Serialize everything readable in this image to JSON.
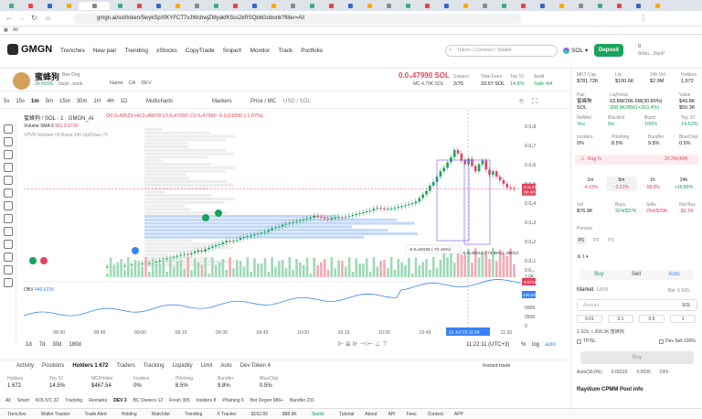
{
  "browser": {
    "url": "gmgn.ai/sol/token/5wykSpXfKYFCT7vJWcbwjZMyakfK5ss2kRSQb6Gobonk?filter=All",
    "bookmark": "All"
  },
  "header": {
    "logo": "GMGN",
    "nav": [
      "Trenches",
      "New pair",
      "Trending",
      "xStocks",
      "CopyTrade",
      "SnipeX",
      "Monitor",
      "Track",
      "Portfolio"
    ],
    "search_placeholder": "Token / Contract / Wallet",
    "chain": "SOL",
    "deposit": "Deposit",
    "wallet_balance": "0",
    "wallet_addr": "8dan...8qoP"
  },
  "token": {
    "name": "蜜蜂狗",
    "sub": "Bee Dog",
    "age": "2h HODL",
    "links": "5wyk...bonk",
    "tags": [
      "Name",
      "CA",
      "DEV"
    ],
    "price": "0.0₄47990 SOL",
    "mc": "MC 4.79K SOL",
    "snipers_label": "Snipers",
    "snipers": "2/70",
    "fees_label": "Total Fees",
    "fees": "33.97 SOL",
    "top10_label": "Top 10",
    "top10": "14.8%",
    "audit_label": "Audit",
    "audit": "Safe 4/4"
  },
  "chart_toolbar": {
    "intervals": [
      "5s",
      "15s",
      "1m",
      "5m",
      "15m",
      "30m",
      "1H",
      "4H",
      "1D"
    ],
    "multicharts": "Multicharts",
    "markers": "Markers",
    "pricemc": "Price / MC",
    "usdsol": "USD / SOL"
  },
  "chart_info": {
    "pair": "蜜蜂狗 / SOL · 1 · GMGN_AI",
    "o": "O0.0₄48529",
    "h": "H0.0₄48678",
    "l": "L0.0₄47990",
    "c": "C0.0₄47990",
    "chg": "-0.0₅51830 (-1.07%)",
    "volume": "Volume SMA 9",
    "vol_val": "961  9.571K",
    "vpvr": "VPVR Number Of Rows 240 Up/Down 70",
    "obv": "OBV",
    "obv_val": "446.621K"
  },
  "chart_data": {
    "type": "candlestick",
    "yticks": [
      "0.0₄8000",
      "0.0₄7000",
      "0.0₄6000",
      "0.0₄5000",
      "0.0₄4000",
      "0.0₄3000",
      "0.0₄2000",
      "0.0₄1000"
    ],
    "xticks": [
      "08:30",
      "08:45",
      "09:00",
      "09:15",
      "09:30",
      "09:45",
      "10:00",
      "10:15",
      "10:30",
      "10:45",
      "11:00",
      "11:30"
    ],
    "ymin": 0,
    "ymax": 8.85e-05,
    "last_price": "0.0₄47990",
    "last_time": "00:48",
    "vol_label": "9.571K",
    "obv_ticks": [
      "500K",
      "250K",
      "0"
    ],
    "crosshair_time": "12 Jul '25  11:09",
    "annot1": "-0.0₄44025 (-74.16%)",
    "annot2": "-0.0₄39012 (-73.85%) -39012",
    "vol_axis": [
      "0.0₁₀",
      "1.0K"
    ],
    "candles": [
      [
        4.35e-06,
        4.4e-06
      ],
      [
        4.4e-06,
        4.5e-06
      ],
      [
        4.5e-06,
        4.6e-06
      ],
      [
        4.6e-06,
        4.7e-06
      ],
      [
        4.7e-06,
        4.8e-06
      ],
      [
        4.8e-06,
        5e-06
      ],
      [
        5e-06,
        5.3e-06
      ],
      [
        5.3e-06,
        5.5e-06
      ],
      [
        5.5e-06,
        5.8e-06
      ],
      [
        5.8e-06,
        6e-06
      ],
      [
        6e-06,
        6.2e-06
      ],
      [
        6.2e-06,
        6.1e-06
      ],
      [
        6.1e-06,
        6.4e-06
      ],
      [
        6.4e-06,
        6.8e-06
      ],
      [
        6.8e-06,
        7.2e-06
      ],
      [
        7.2e-06,
        7.8e-06
      ],
      [
        7.8e-06,
        8.5e-06
      ],
      [
        8.5e-06,
        9e-06
      ],
      [
        9e-06,
        9.5e-06
      ],
      [
        9.5e-06,
        1e-05
      ],
      [
        1e-05,
        1.05e-05
      ],
      [
        1.05e-05,
        1.1e-05
      ],
      [
        1.1e-05,
        1.15e-05
      ],
      [
        1.15e-05,
        1.12e-05
      ],
      [
        1.12e-05,
        1.2e-05
      ],
      [
        1.2e-05,
        1.28e-05
      ],
      [
        1.28e-05,
        1.35e-05
      ],
      [
        1.35e-05,
        1.3e-05
      ],
      [
        1.3e-05,
        1.42e-05
      ],
      [
        1.42e-05,
        1.5e-05
      ],
      [
        1.5e-05,
        1.58e-05
      ],
      [
        1.58e-05,
        1.65e-05
      ],
      [
        1.65e-05,
        1.7e-05
      ],
      [
        1.7e-05,
        1.8e-05
      ],
      [
        1.8e-05,
        1.9e-05
      ],
      [
        1.9e-05,
        1.85e-05
      ],
      [
        1.85e-05,
        1.9e-05
      ],
      [
        1.9e-05,
        1.95e-05
      ],
      [
        1.95e-05,
        2.05e-05
      ],
      [
        2.05e-05,
        2.1e-05
      ],
      [
        2.1e-05,
        2.15e-05
      ],
      [
        2.15e-05,
        2.2e-05
      ],
      [
        2.2e-05,
        2.25e-05
      ],
      [
        2.25e-05,
        2.3e-05
      ],
      [
        2.3e-05,
        2.35e-05
      ],
      [
        2.35e-05,
        2.4e-05
      ],
      [
        2.4e-05,
        2.5e-05
      ],
      [
        2.5e-05,
        2.6e-05
      ],
      [
        2.6e-05,
        2.65e-05
      ],
      [
        2.65e-05,
        2.7e-05
      ],
      [
        2.7e-05,
        2.8e-05
      ],
      [
        2.8e-05,
        2.85e-05
      ],
      [
        2.85e-05,
        2.9e-05
      ],
      [
        2.9e-05,
        2.95e-05
      ],
      [
        2.95e-05,
        3e-05
      ],
      [
        3e-05,
        3.05e-05
      ],
      [
        3.05e-05,
        3.1e-05
      ],
      [
        3.1e-05,
        3.15e-05
      ],
      [
        3.15e-05,
        3.2e-05
      ],
      [
        3.2e-05,
        3.3e-05
      ],
      [
        3.3e-05,
        3.25e-05
      ],
      [
        3.25e-05,
        3.2e-05
      ],
      [
        3.2e-05,
        3.15e-05
      ],
      [
        3.15e-05,
        3.1e-05
      ],
      [
        3.1e-05,
        3.18e-05
      ],
      [
        3.18e-05,
        3.2e-05
      ],
      [
        3.2e-05,
        3.23e-05
      ],
      [
        3.23e-05,
        3.2e-05
      ],
      [
        3.2e-05,
        3.25e-05
      ],
      [
        3.25e-05,
        3.3e-05
      ],
      [
        3.3e-05,
        3.35e-05
      ],
      [
        3.35e-05,
        3.4e-05
      ],
      [
        3.4e-05,
        3.45e-05
      ],
      [
        3.45e-05,
        3.5e-05
      ],
      [
        3.5e-05,
        3.55e-05
      ],
      [
        3.55e-05,
        3.6e-05
      ],
      [
        3.6e-05,
        3.7e-05
      ],
      [
        3.7e-05,
        3.75e-05
      ],
      [
        3.75e-05,
        3.7e-05
      ],
      [
        3.7e-05,
        3.68e-05
      ],
      [
        3.68e-05,
        3.7e-05
      ],
      [
        3.7e-05,
        3.72e-05
      ],
      [
        3.72e-05,
        3.75e-05
      ],
      [
        3.75e-05,
        3.8e-05
      ],
      [
        3.8e-05,
        3.85e-05
      ],
      [
        3.85e-05,
        3.9e-05
      ],
      [
        3.9e-05,
        3.95e-05
      ],
      [
        3.95e-05,
        4e-05
      ],
      [
        4e-05,
        4.1e-05
      ],
      [
        4.1e-05,
        4.3e-05
      ],
      [
        4.3e-05,
        4.5e-05
      ],
      [
        4.5e-05,
        4.7e-05
      ],
      [
        4.7e-05,
        5e-05
      ],
      [
        5e-05,
        5.2e-05
      ],
      [
        5.2e-05,
        5.5e-05
      ],
      [
        5.5e-05,
        5.8e-05
      ],
      [
        5.8e-05,
        6e-05
      ],
      [
        6e-05,
        6.3e-05
      ],
      [
        6.3e-05,
        6.6e-05
      ],
      [
        6.6e-05,
        7e-05
      ],
      [
        7e-05,
        6.8e-05
      ],
      [
        6.8e-05,
        6.4e-05
      ],
      [
        6.4e-05,
        6.2e-05
      ],
      [
        6.2e-05,
        6.5e-05
      ],
      [
        6.5e-05,
        6.1e-05
      ],
      [
        6.1e-05,
        5.8e-05
      ],
      [
        5.8e-05,
        6.2e-05
      ],
      [
        6.2e-05,
        6.4e-05
      ],
      [
        6.4e-05,
        5.9e-05
      ],
      [
        5.9e-05,
        5.6e-05
      ],
      [
        5.6e-05,
        5.8e-05
      ],
      [
        5.8e-05,
        5.5e-05
      ],
      [
        5.5e-05,
        5.3e-05
      ],
      [
        5.3e-05,
        5.1e-05
      ],
      [
        5.1e-05,
        4.9e-05
      ],
      [
        4.9e-05,
        4.85e-05
      ],
      [
        4.85e-05,
        4.799e-05
      ]
    ]
  },
  "bottom_toolbar": {
    "ranges": [
      "1d",
      "7d",
      "30d",
      "180d"
    ],
    "time": "11:22:11 (UTC+3)",
    "pct": "%",
    "log": "log",
    "auto": "auto"
  },
  "bottom_tabs": {
    "tabs": [
      "Activity",
      "Positions",
      "Holders 1 672",
      "Traders",
      "Tracking",
      "Liquidity",
      "Limit",
      "Auto",
      "Dev Token 4"
    ],
    "instant": "Instant trade"
  },
  "bottom_stats": {
    "labels": [
      "Holders",
      "Top 10",
      "MC/Holder",
      "Insiders",
      "Phishing",
      "Bundler",
      "BlueChip"
    ],
    "values": [
      "1 672",
      "14.5%",
      "$467.54",
      "0%",
      "8.5%",
      "9.8%",
      "0.5%"
    ]
  },
  "bottom_filters": [
    "All",
    "Smart",
    "KOL/VC 22",
    "Tracking",
    "Remarks",
    "DEV 3",
    "BC Owners 12",
    "Fresh 305",
    "Insiders 8",
    "Phishing 6",
    "Bot Degen 986+",
    "Bundler 231"
  ],
  "statusbar": [
    "Trenches",
    "Wallet Tracker",
    "Trade Alert",
    "Holding",
    "Watchlist",
    "Trending",
    "X Tracker",
    "$162.89",
    "$98.9K",
    "Stable",
    "Tutorial",
    "About",
    "API",
    "Fees",
    "Contest",
    "APP"
  ],
  "right": {
    "mcap_l": "MKT Cap",
    "mcap": "$781.72K",
    "liq_l": "Liq",
    "liq": "$100.6K",
    "vol24_l": "24h Vol",
    "vol24": "$2.9M",
    "hold_l": "Holders",
    "hold": "1,672",
    "pair_l": "Pair",
    "pair": "蜜蜂狗",
    "pair2": "SOL",
    "liqinit_l": "Liq/Initial",
    "liqinit": "63.8M/206.9M(30.89%)",
    "liqinit2": "308.8K/85K(+263.4%)",
    "vol_l": "Value",
    "vol": "$49.8K",
    "vol2": "$50.3K",
    "nomint_l": "NoMint",
    "nomint": "Yes",
    "black_l": "Blacklist",
    "black": "No",
    "burnt_l": "Burnt",
    "burnt": "100%",
    "top10_l": "Top 10",
    "top10": "14.52%",
    "ins_l": "Insiders",
    "ins": "0%",
    "phish_l": "Phishing",
    "phish": "8.5%",
    "bund_l": "Bundler",
    "bund": "9.8%",
    "blue_l": "BlueChip",
    "blue": "0.5%",
    "rug": "Rug %",
    "rugval": "20.2%(404)",
    "tf": [
      "1m",
      "5m",
      "1h",
      "24h"
    ],
    "tfv": [
      "-4.03%",
      "-3.21%",
      "-58.8%",
      "+16.86%"
    ],
    "vol5_l": "Vol",
    "vol5": "$76.9K",
    "buys_l": "Buys",
    "buys": "324/$37K",
    "sells_l": "Sells",
    "sells": "294/$39K",
    "net_l": "Net Buy",
    "net": "-$1.5K",
    "presets": "Presets",
    "p": [
      "P1",
      "P2",
      "P3"
    ],
    "buy": "Buy",
    "sell": "Sell",
    "auto": "Auto",
    "market": "Market",
    "limit": "Limit",
    "bal": "Bal: 0 SOL",
    "amount": "Amount",
    "amt_unit": "SOL",
    "chips": [
      "0.01",
      "0.1",
      "0.5",
      "1"
    ],
    "conv": "1 SOL ≈ 208.3K 蜜蜂狗",
    "tpsl": "TP/SL",
    "devsell": "Dev Sell 100%",
    "bigbuy": "Buy",
    "fees": [
      "Auto(30.0%)",
      "0.00115",
      "0.0035",
      "OFF"
    ],
    "pool": "Raydium CPMM Pool info"
  }
}
